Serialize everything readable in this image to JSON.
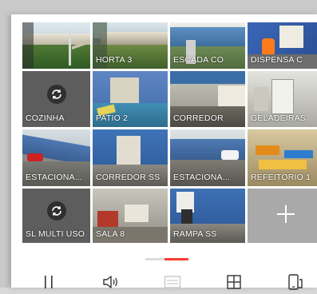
{
  "cameras": [
    {
      "label": ""
    },
    {
      "label": "HORTA 3"
    },
    {
      "label": "ESCADA CO"
    },
    {
      "label": "DISPENSA C"
    },
    {
      "label": "COZINHA"
    },
    {
      "label": "PATIO 2"
    },
    {
      "label": "CORREDOR"
    },
    {
      "label": "GELADEIRAS"
    },
    {
      "label": "ESTACIONA..."
    },
    {
      "label": "CORREDOR SS"
    },
    {
      "label": "ESTACIONA..."
    },
    {
      "label": "REFEITORIO 1"
    },
    {
      "label": "SL MULTI USO"
    },
    {
      "label": "SALA 8"
    },
    {
      "label": "RAMPA SS"
    }
  ],
  "icons": {
    "refresh": "refresh-icon",
    "add": "plus-icon",
    "pause": "pause-icon",
    "volume": "volume-icon",
    "quality": "stream-quality-icon",
    "layout": "grid-layout-icon",
    "rotate": "rotate-screen-icon"
  },
  "colors": {
    "selected_border": "#ff5a2a",
    "pager_active": "#ff3b30",
    "offline_tile": "#5d5d5d",
    "add_tile": "#a9a9a9"
  },
  "pager": {
    "pages": 2,
    "active": 2
  }
}
